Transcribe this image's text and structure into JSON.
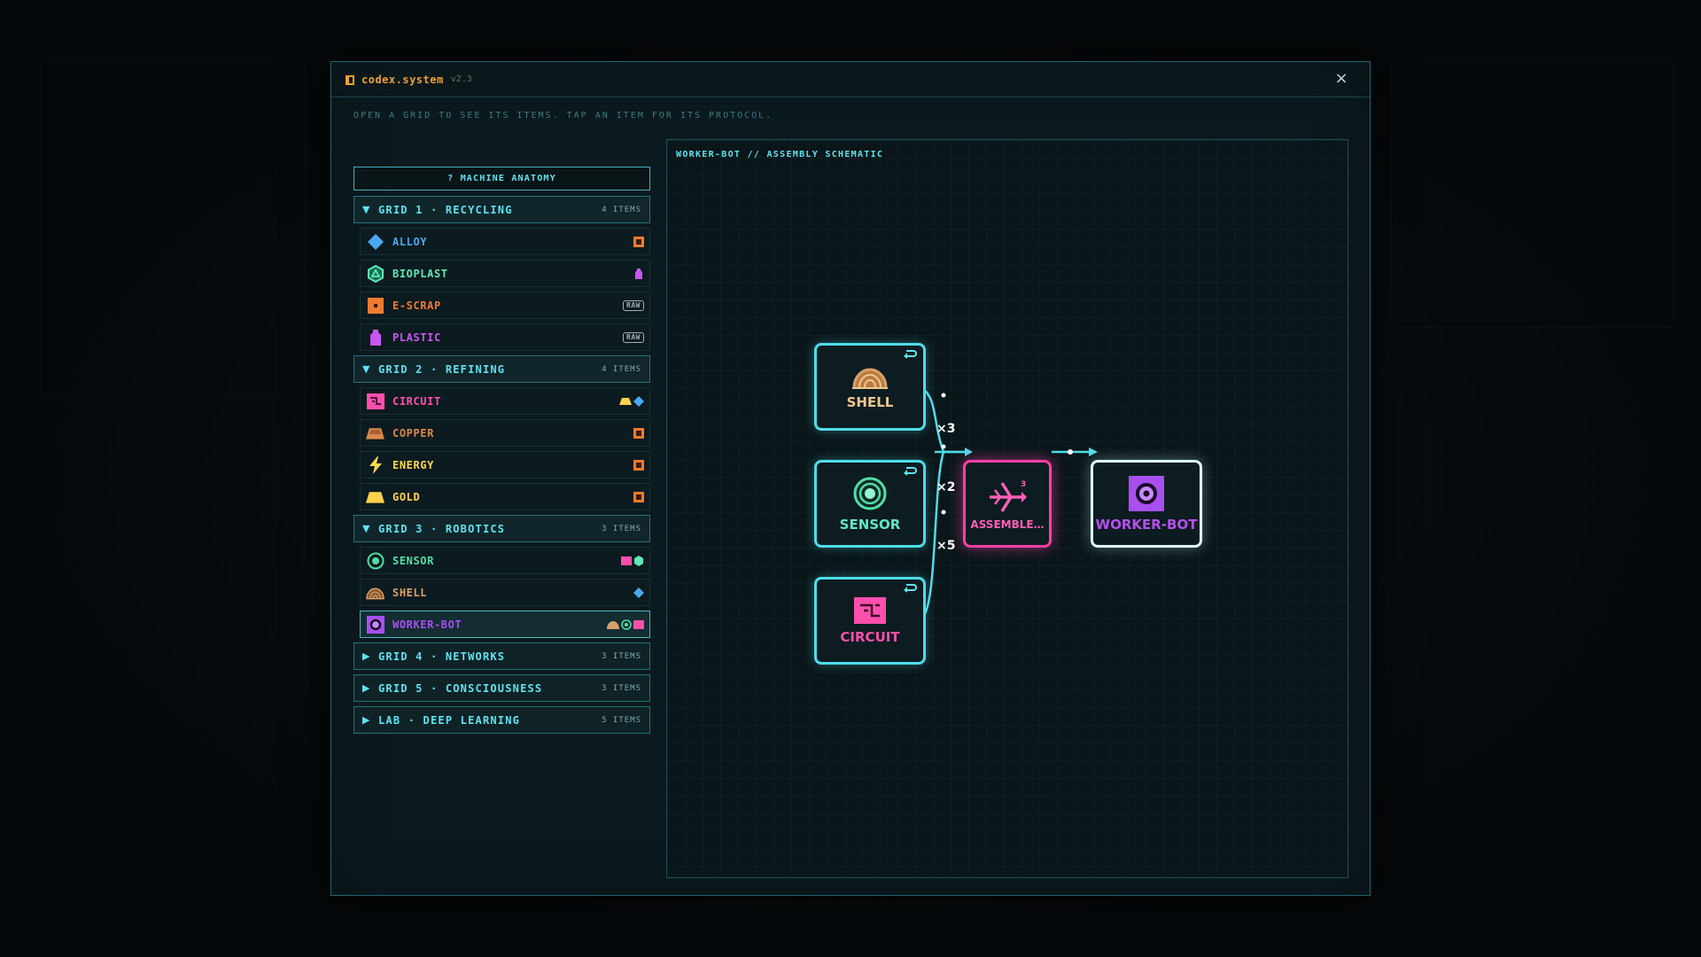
{
  "window": {
    "title": "codex.system",
    "version": "v2.3",
    "close_glyph": "×",
    "instructions": "OPEN A GRID TO SEE ITS ITEMS. TAP AN ITEM FOR ITS PROTOCOL."
  },
  "sidebar": {
    "anatomy_label": "? MACHINE ANATOMY",
    "grids": [
      {
        "title": "GRID 1 · RECYCLING",
        "count": "4 ITEMS",
        "expanded": true,
        "items": [
          {
            "label": "ALLOY",
            "icon": "diamond-icon",
            "color": "#4aa8f0"
          },
          {
            "label": "BIOPLAST",
            "icon": "hexagon-icon",
            "color": "#5fe8b8"
          },
          {
            "label": "E-SCRAP",
            "icon": "chip-icon",
            "color": "#f07a30",
            "tag": "RAW"
          },
          {
            "label": "PLASTIC",
            "icon": "bottle-icon",
            "color": "#c857f0",
            "tag": "RAW"
          }
        ]
      },
      {
        "title": "GRID 2 · REFINING",
        "count": "4 ITEMS",
        "expanded": true,
        "items": [
          {
            "label": "CIRCUIT",
            "icon": "circuit-icon",
            "color": "#ff4fae"
          },
          {
            "label": "COPPER",
            "icon": "ingot-icon",
            "color": "#d9884a"
          },
          {
            "label": "ENERGY",
            "icon": "bolt-icon",
            "color": "#ffd84a"
          },
          {
            "label": "GOLD",
            "icon": "gold-bar-icon",
            "color": "#ffd34a"
          }
        ]
      },
      {
        "title": "GRID 3 · ROBOTICS",
        "count": "3 ITEMS",
        "expanded": true,
        "items": [
          {
            "label": "SENSOR",
            "icon": "sensor-icon",
            "color": "#4fe0a8"
          },
          {
            "label": "SHELL",
            "icon": "shell-icon",
            "color": "#d9a06a"
          },
          {
            "label": "WORKER-BOT",
            "icon": "bot-icon",
            "color": "#a84ff0",
            "selected": true
          }
        ]
      },
      {
        "title": "GRID 4 · NETWORKS",
        "count": "3 ITEMS",
        "expanded": false
      },
      {
        "title": "GRID 5 · CONSCIOUSNESS",
        "count": "3 ITEMS",
        "expanded": false
      },
      {
        "title": "LAB · DEEP LEARNING",
        "count": "5 ITEMS",
        "expanded": false
      }
    ]
  },
  "schematic": {
    "title": "WORKER-BOT // ASSEMBLY SCHEMATIC",
    "inputs": [
      {
        "label": "SHELL",
        "qty": "×3",
        "color": "#f0c890",
        "icon": "shell-icon"
      },
      {
        "label": "SENSOR",
        "qty": "×2",
        "color": "#5fe8c8",
        "icon": "sensor-icon"
      },
      {
        "label": "CIRCUIT",
        "qty": "×5",
        "color": "#ff4fae",
        "icon": "circuit-icon"
      }
    ],
    "assembler": {
      "label": "ASSEMBLE…",
      "level": "3",
      "color": "#ff3fa6",
      "icon": "assembler-icon"
    },
    "output": {
      "label": "WORKER-BOT",
      "color": "#b84ff0",
      "icon": "bot-icon"
    }
  },
  "colors": {
    "accent": "#5fe3f0",
    "title": "#f0a030",
    "wire": "#4fdcea"
  }
}
